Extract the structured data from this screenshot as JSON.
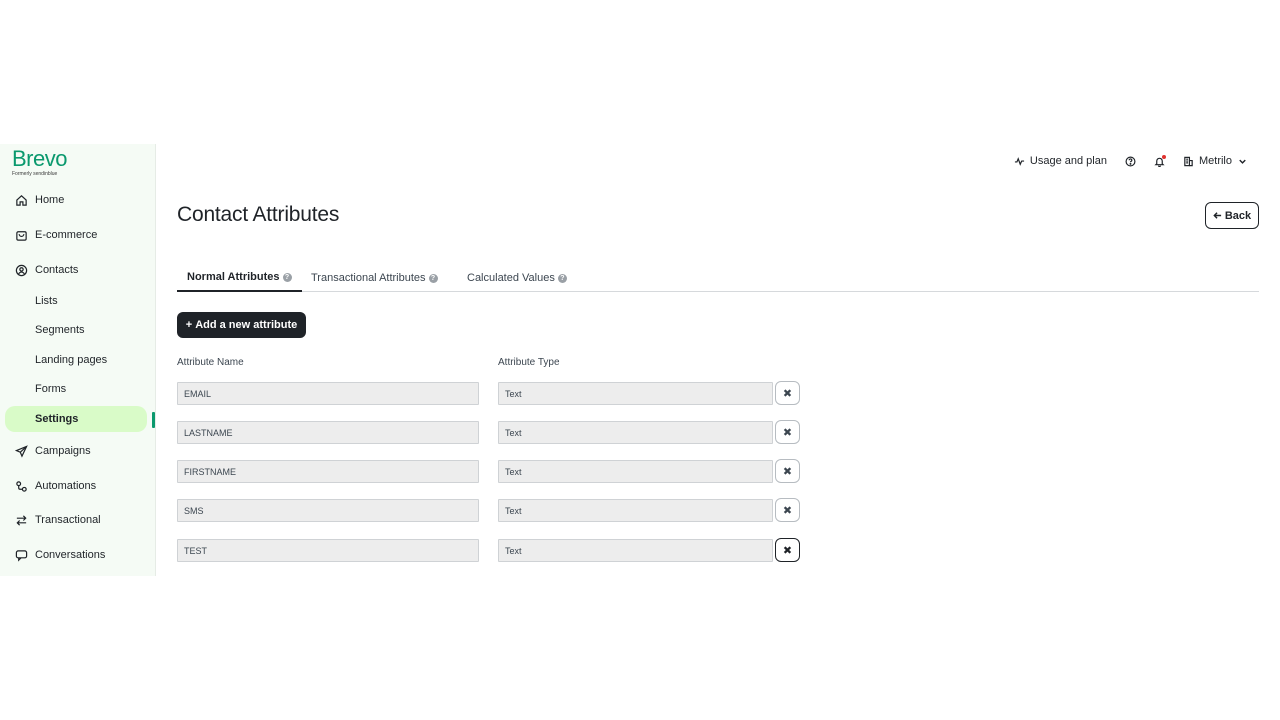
{
  "brand": {
    "name": "Brevo",
    "tagline": "Formerly sendinblue",
    "color": "#0b996e"
  },
  "sidebar": {
    "items": [
      {
        "label": "Home",
        "icon": "home-icon"
      },
      {
        "label": "E-commerce",
        "icon": "shopping-bag-icon"
      },
      {
        "label": "Contacts",
        "icon": "contacts-icon"
      },
      {
        "label": "Campaigns",
        "icon": "send-icon"
      },
      {
        "label": "Automations",
        "icon": "automation-icon"
      },
      {
        "label": "Transactional",
        "icon": "transfer-icon"
      },
      {
        "label": "Conversations",
        "icon": "chat-icon"
      }
    ],
    "contacts_sub": [
      "Lists",
      "Segments",
      "Landing pages",
      "Forms",
      "Settings"
    ],
    "active_item": "Settings",
    "active_bg": "#d9fbc8"
  },
  "topbar": {
    "usage_label": "Usage and plan",
    "account_label": "Metrilo"
  },
  "main": {
    "title": "Contact Attributes",
    "back_label": "Back",
    "tabs": [
      {
        "label": "Normal Attributes",
        "active": true
      },
      {
        "label": "Transactional Attributes",
        "active": false
      },
      {
        "label": "Calculated Values",
        "active": false
      }
    ],
    "add_label": "Add a new attribute",
    "col_name_label": "Attribute Name",
    "col_type_label": "Attribute Type",
    "attributes": [
      {
        "name": "EMAIL",
        "type": "Text"
      },
      {
        "name": "LASTNAME",
        "type": "Text"
      },
      {
        "name": "FIRSTNAME",
        "type": "Text"
      },
      {
        "name": "SMS",
        "type": "Text"
      },
      {
        "name": "TEST",
        "type": "Text"
      }
    ]
  }
}
